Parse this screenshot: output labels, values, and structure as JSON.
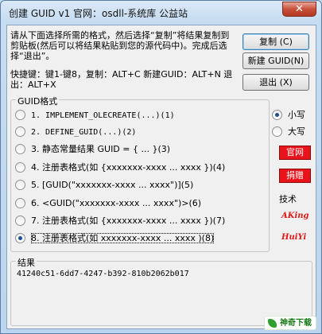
{
  "window": {
    "title": "创建 GUID v1   官网：osdll-系统库  公益站",
    "close_glyph": "✕"
  },
  "instructions": "请从下面选择所需的格式，然后选择“复制”将结果复制到剪贴板(然后可以将结果粘贴到您的源代码中)。完成后选择“退出”。",
  "shortcuts": "快捷键：键1-键8，复制：ALT+C  新建GUID：ALT+N  退出：ALT+X",
  "buttons": {
    "copy": "复制 (C)",
    "new_guid": "新建 GUID(N)",
    "exit": "退出 (X)"
  },
  "format_group": {
    "legend": "GUID格式",
    "selected_index": 7,
    "options": [
      "1. IMPLEMENT_OLECREATE(...)(1)",
      "2. DEFINE_GUID(...)(2)",
      "3. 静态常量结果 GUID = { ... }(3)",
      "4. 注册表格式(如 {xxxxxxx-xxxx ... xxxx })(4)",
      "5. [GUID(\"xxxxxxx-xxxx ... xxxx\")](5)",
      "6. <GUID(\"xxxxxxx-xxxx ... xxxx\")>(6)",
      "7. 注册表格式(如 {xxxxxxx-xxxx ... xxxx })(7)",
      "8. 注册表格式(如 xxxxxxx-xxxx ... xxxx )(8)"
    ]
  },
  "case_options": {
    "lower": "小写",
    "upper": "大写",
    "selected": "lower"
  },
  "links": {
    "website": "官网",
    "donate": "捐赠"
  },
  "tech": {
    "label": "技术",
    "author1": "AKing",
    "author2": "HuiYi"
  },
  "result": {
    "legend": "结果",
    "value": "41240c51-6dd7-4247-b392-810b2062b017"
  },
  "watermark": "神奇下载",
  "colors": {
    "accent_red": "#e8131b",
    "author_red": "#e01818",
    "radio_fill": "#1e4f91"
  }
}
